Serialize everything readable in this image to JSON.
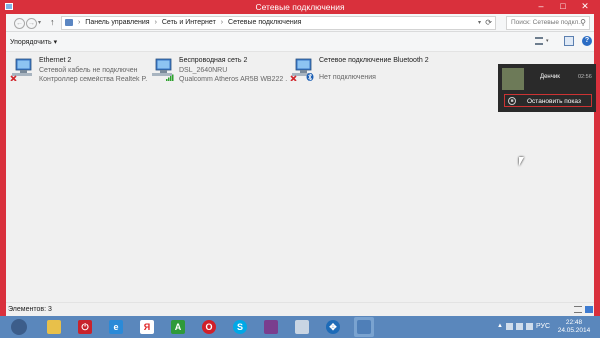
{
  "window": {
    "title": "Сетевые подключения"
  },
  "address": {
    "crumbs": [
      "Панель управления",
      "Сеть и Интернет",
      "Сетевые подключения"
    ],
    "separator": "›"
  },
  "search": {
    "placeholder": "Поиск: Сетевые подкл..."
  },
  "toolbar": {
    "organize": "Упорядочить ▾"
  },
  "connections": [
    {
      "name": "Ethernet 2",
      "status": "Сетевой кабель не подключен",
      "device": "Контроллер семейства Realtek P...",
      "icon": "ethernet-adapter-disconnected-icon"
    },
    {
      "name": "Беспроводная сеть 2",
      "status": "DSL_2640NRU",
      "device": "Qualcomm Atheros AR5B WB222 ...",
      "icon": "wireless-adapter-icon"
    },
    {
      "name": "Сетевое подключение Bluetooth 2",
      "status": "Нет подключения",
      "device": "",
      "icon": "bluetooth-adapter-disconnected-icon"
    }
  ],
  "statusbar": {
    "count": "Элементов: 3"
  },
  "media_popup": {
    "name": "Денчик",
    "time": "02:56",
    "stop_label": "Остановить показ"
  },
  "taskbar": {
    "apps": [
      "explorer-icon",
      "power-icon",
      "ie-icon",
      "yandex-icon",
      "android-icon",
      "opera-icon",
      "skype-icon",
      "winrar-icon",
      "network-folder-icon",
      "nodes-icon",
      "control-panel-icon"
    ],
    "language": "РУС",
    "time": "22:48",
    "date": "24.05.2014"
  },
  "colors": {
    "titlebar": "#d9303c",
    "taskbar": "#5a87bc",
    "client": "#f0f0f0"
  }
}
